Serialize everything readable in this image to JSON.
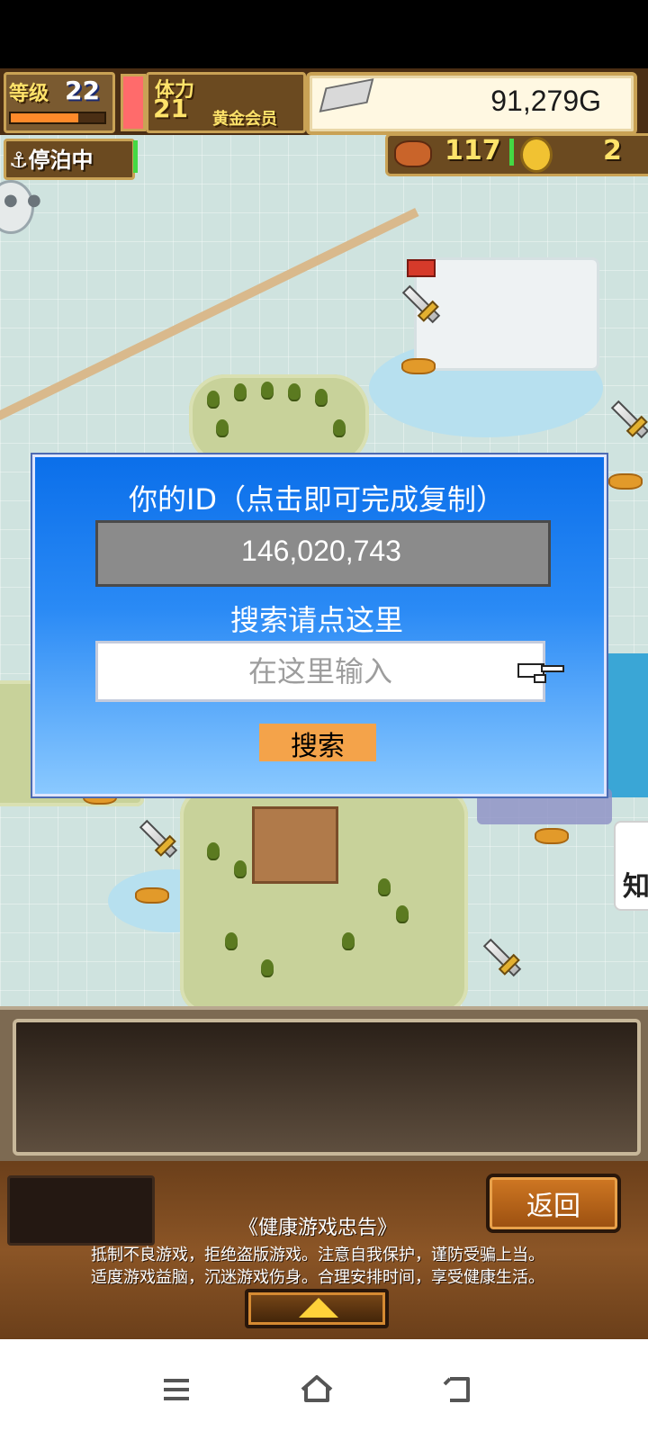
{
  "hud": {
    "level_label": "等级",
    "level": "22",
    "level_progress": 0.72,
    "stamina_label": "体力",
    "stamina": "21",
    "member_label": "黄金会员",
    "gold": "91,279G",
    "docked_label": "停泊中",
    "food": "117",
    "coins": "2"
  },
  "dialog": {
    "title": "你的ID（点击即可完成复制）",
    "id_value": "146,020,743",
    "search_hint": "搜索请点这里",
    "search_placeholder": "在这里输入",
    "search_button": "搜索"
  },
  "side_card": {
    "char": "知"
  },
  "bottom": {
    "back_button": "返回",
    "notice_title": "《健康游戏忠告》",
    "notice_line1": "抵制不良游戏，拒绝盗版游戏。注意自我保护，谨防受骗上当。",
    "notice_line2": "适度游戏益脑，沉迷游戏伤身。合理安排时间，享受健康生活。"
  },
  "icons": {
    "chat": "chat-bubble-icon",
    "gold": "silver-bar-icon",
    "food": "meat-icon",
    "coin": "coin-icon",
    "hand": "pointing-hand-icon",
    "up": "up-arrow-icon",
    "nav_menu": "menu-icon",
    "nav_home": "home-icon",
    "nav_back": "back-icon"
  },
  "colors": {
    "dialog_blue": "#0b6fea",
    "search_button": "#f4a34a",
    "hud_brown": "#6b4a20",
    "hud_gold": "#ffe36a"
  }
}
